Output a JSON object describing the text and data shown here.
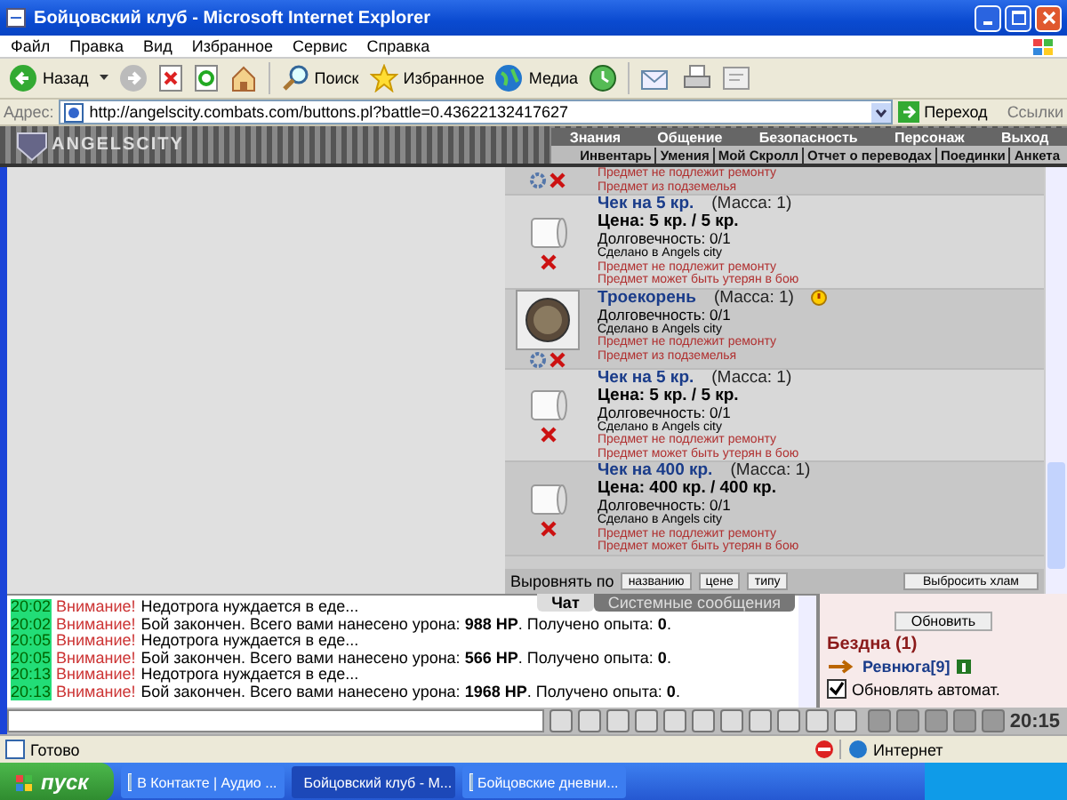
{
  "window": {
    "title": "Бойцовский клуб - Microsoft Internet Explorer"
  },
  "menu": [
    "Файл",
    "Правка",
    "Вид",
    "Избранное",
    "Сервис",
    "Справка"
  ],
  "toolbar": {
    "back": "Назад",
    "search": "Поиск",
    "favorites": "Избранное",
    "media": "Медиа"
  },
  "address": {
    "label": "Адрес:",
    "url": "http://angelscity.combats.com/buttons.pl?battle=0.43622132417627",
    "go": "Переход",
    "links": "Ссылки"
  },
  "game": {
    "logo": "ANGELSCITY",
    "nav_top": [
      "Знания",
      "Общение",
      "Безопасность",
      "Персонаж",
      "Выход"
    ],
    "nav_bottom": [
      "Инвентарь",
      "Умения",
      "Мой Скролл",
      "Отчет о переводах",
      "Поединки",
      "Анкета"
    ]
  },
  "inventory": {
    "top_partial": {
      "notes": [
        "Предмет не подлежит ремонту",
        "Предмет из подземелья"
      ]
    },
    "items": [
      {
        "kind": "scroll",
        "name": "Чек на 5 кр.",
        "mass": "(Масса: 1)",
        "price": "Цена: 5 кр. / 5 кр.",
        "durability": "Долговечность: 0/1",
        "made": "Сделано в Angels city",
        "notes": [
          "Предмет не подлежит ремонту",
          "Предмет может быть утерян в бою"
        ]
      },
      {
        "kind": "coin",
        "name": "Троекорень",
        "mass": "(Масса: 1)",
        "durability": "Долговечность: 0/1",
        "made": "Сделано в Angels city",
        "notes": [
          "Предмет не подлежит ремонту",
          "Предмет из подземелья"
        ]
      },
      {
        "kind": "scroll",
        "name": "Чек на 5 кр.",
        "mass": "(Масса: 1)",
        "price": "Цена: 5 кр. / 5 кр.",
        "durability": "Долговечность: 0/1",
        "made": "Сделано в Angels city",
        "notes": [
          "Предмет не подлежит ремонту",
          "Предмет может быть утерян в бою"
        ]
      },
      {
        "kind": "scroll",
        "name": "Чек на 400 кр.",
        "mass": "(Масса: 1)",
        "price": "Цена: 400 кр. / 400 кр.",
        "durability": "Долговечность: 0/1",
        "made": "Сделано в Angels city",
        "notes": [
          "Предмет не подлежит ремонту",
          "Предмет может быть утерян в бою"
        ]
      }
    ],
    "sort_label": "Выровнять по",
    "sort_buttons": [
      "названию",
      "цене",
      "типу"
    ],
    "discard": "Выбросить хлам"
  },
  "chat": {
    "lines": [
      {
        "time": "20:02",
        "warn": "Внимание!",
        "text": "Недотрога нуждается в еде..."
      },
      {
        "time": "20:02",
        "warn": "Внимание!",
        "text": "Бой закончен. Всего вами нанесено урона: **988 HP**. Получено опыта: **0**."
      },
      {
        "time": "20:05",
        "warn": "Внимание!",
        "text": "Недотрога нуждается в еде..."
      },
      {
        "time": "20:05",
        "warn": "Внимание!",
        "text": "Бой закончен. Всего вами нанесено урона: **566 HP**. Получено опыта: **0**."
      },
      {
        "time": "20:13",
        "warn": "Внимание!",
        "text": "Недотрога нуждается в еде..."
      },
      {
        "time": "20:13",
        "warn": "Внимание!",
        "text": "Бой закончен. Всего вами нанесено урона: **1968 HP**. Получено опыта: **0**."
      }
    ],
    "tabs": [
      {
        "label": "Чат",
        "selected": true
      },
      {
        "label": "Системные сообщения",
        "selected": false
      }
    ]
  },
  "online": {
    "refresh": "Обновить",
    "room": "Бездна (1)",
    "user": "Ревнюга[9]",
    "auto": {
      "label": "Обновлять автомат.",
      "checked": true
    },
    "clock": "20:15"
  },
  "status_bar": {
    "text": "Готово",
    "zone": "Интернет"
  },
  "taskbar": {
    "start": "пуск",
    "tasks": [
      {
        "label": "В Контакте | Аудио ...",
        "selected": false
      },
      {
        "label": "Бойцовский клуб - M...",
        "selected": true
      },
      {
        "label": "Бойцовские дневни...",
        "selected": false
      }
    ]
  }
}
